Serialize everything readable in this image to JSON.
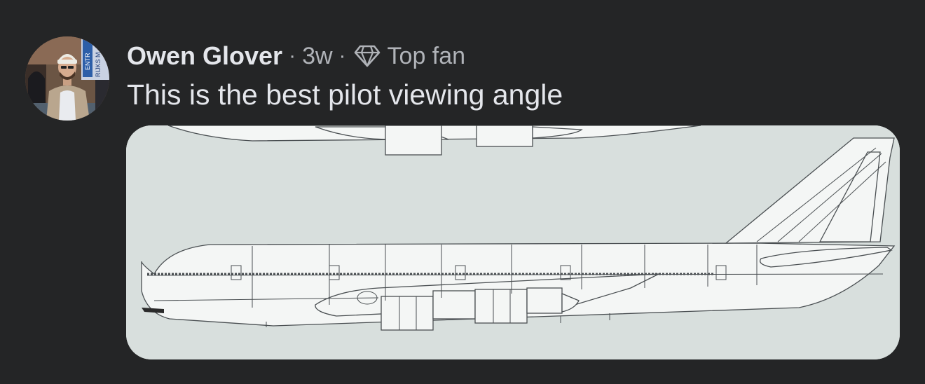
{
  "comment": {
    "author": "Owen Glover",
    "separator": "·",
    "time": "3w",
    "badge": {
      "icon": "diamond-icon",
      "label": "Top fan"
    },
    "text": "This is the best pilot viewing angle"
  },
  "avatar": {
    "sign_text_1": "ENTR",
    "sign_text_2": "RIJKS M"
  },
  "colors": {
    "background": "#242526",
    "primary_text": "#e4e6eb",
    "secondary_text": "#b0b3b8",
    "image_background": "#d8dfdd"
  }
}
